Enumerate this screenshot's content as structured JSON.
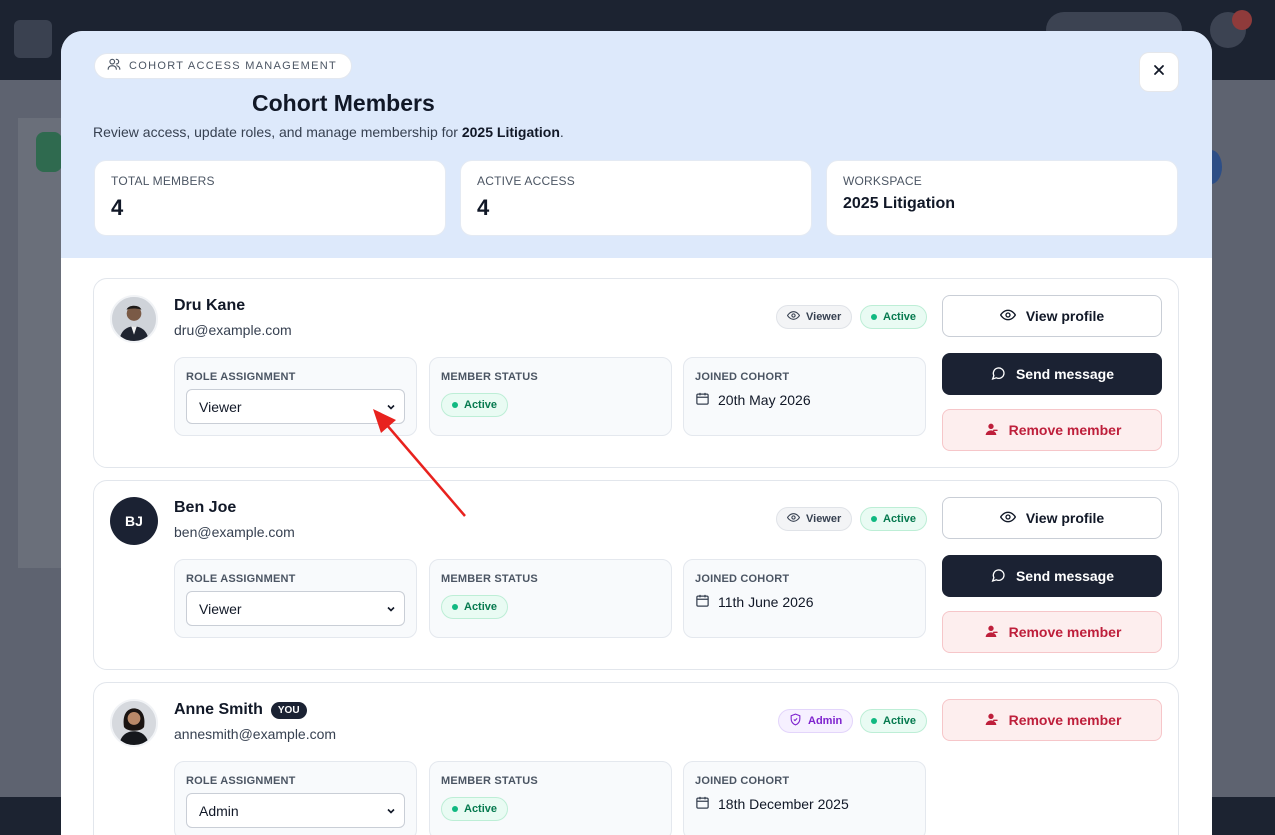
{
  "header": {
    "chip": "COHORT ACCESS MANAGEMENT",
    "title": "Cohort Members",
    "subtitle_prefix": "Review access, update roles, and manage membership for ",
    "subtitle_workspace": "2025 Litigation",
    "subtitle_suffix": "."
  },
  "stats": [
    {
      "label": "TOTAL MEMBERS",
      "value": "4"
    },
    {
      "label": "ACTIVE ACCESS",
      "value": "4"
    },
    {
      "label": "WORKSPACE",
      "value": "2025 Litigation"
    }
  ],
  "labels": {
    "role": "ROLE ASSIGNMENT",
    "status": "MEMBER STATUS",
    "joined": "JOINED COHORT"
  },
  "members": [
    {
      "name": "Dru Kane",
      "email": "dru@example.com",
      "role_badge": "Viewer",
      "status_badge": "Active",
      "role": "Viewer",
      "status": "Active",
      "joined": "20th May 2026",
      "actions": {
        "view": "View profile",
        "message": "Send message",
        "remove": "Remove member"
      }
    },
    {
      "name": "Ben Joe",
      "initials": "BJ",
      "email": "ben@example.com",
      "role_badge": "Viewer",
      "status_badge": "Active",
      "role": "Viewer",
      "status": "Active",
      "joined": "11th June 2026",
      "actions": {
        "view": "View profile",
        "message": "Send message",
        "remove": "Remove member"
      }
    },
    {
      "name": "Anne Smith",
      "you_badge": "YOU",
      "email": "annesmith@example.com",
      "role_badge": "Admin",
      "status_badge": "Active",
      "role": "Admin",
      "status": "Active",
      "joined": "18th December 2025",
      "actions": {
        "remove": "Remove member"
      }
    }
  ],
  "colors": {
    "header_bg": "#dde9fb",
    "primary_dark": "#1b2233",
    "active_green": "#067a4f",
    "danger_red": "#be1f3b",
    "admin_purple": "#7e22ce",
    "annotation_arrow": "#e8221e"
  },
  "icons": {
    "chip": "users-icon",
    "close": "close-icon",
    "viewer": "eye-icon",
    "admin": "shield-icon",
    "message": "chat-bubble-icon",
    "remove": "user-remove-icon",
    "date": "calendar-icon",
    "select": "chevron-down-icon"
  }
}
